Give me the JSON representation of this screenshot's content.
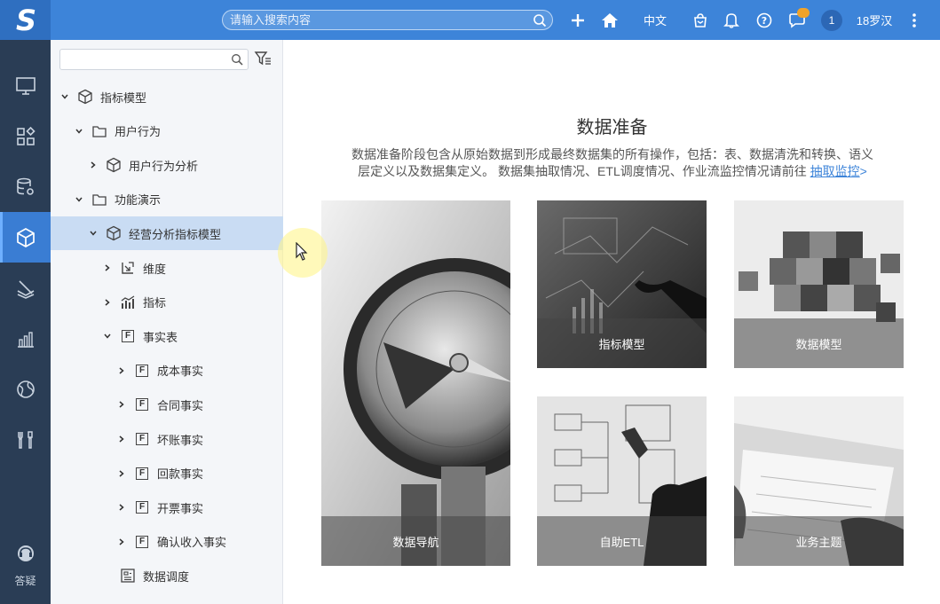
{
  "app": {
    "logo_text": "S"
  },
  "topbar": {
    "search_placeholder": "请输入搜索内容",
    "lang": "中文",
    "user_count": "1",
    "user_name": "18罗汉",
    "accent": "#3d84d9"
  },
  "rail": {
    "items": [
      {
        "icon": "monitor-icon"
      },
      {
        "icon": "apps-icon"
      },
      {
        "icon": "database-settings-icon"
      },
      {
        "icon": "cube-icon",
        "active": true
      },
      {
        "icon": "layers-icon"
      },
      {
        "icon": "bar-chart-icon"
      },
      {
        "icon": "globe-icon"
      },
      {
        "icon": "tools-icon"
      }
    ],
    "help_label": "答疑"
  },
  "tree": {
    "nodes": [
      {
        "label": "指标模型",
        "icon": "cube-icon",
        "caret": "down",
        "indent": 0
      },
      {
        "label": "用户行为",
        "icon": "folder-icon",
        "caret": "down",
        "indent": 1
      },
      {
        "label": "用户行为分析",
        "icon": "cube-icon",
        "caret": "right",
        "indent": 2
      },
      {
        "label": "功能演示",
        "icon": "folder-icon",
        "caret": "down",
        "indent": 1
      },
      {
        "label": "经营分析指标模型",
        "icon": "cube-icon",
        "caret": "down",
        "indent": 2,
        "selected": true
      },
      {
        "label": "维度",
        "icon": "dimension-icon",
        "caret": "right",
        "indent": 3
      },
      {
        "label": "指标",
        "icon": "metric-icon",
        "caret": "right",
        "indent": 3
      },
      {
        "label": "事实表",
        "icon": "fact-table-icon",
        "caret": "down",
        "indent": 3
      },
      {
        "label": "成本事实",
        "icon": "fact-table-icon",
        "caret": "right",
        "indent": 4
      },
      {
        "label": "合同事实",
        "icon": "fact-table-icon",
        "caret": "right",
        "indent": 4
      },
      {
        "label": "坏账事实",
        "icon": "fact-table-icon",
        "caret": "right",
        "indent": 4
      },
      {
        "label": "回款事实",
        "icon": "fact-table-icon",
        "caret": "right",
        "indent": 4
      },
      {
        "label": "开票事实",
        "icon": "fact-table-icon",
        "caret": "right",
        "indent": 4
      },
      {
        "label": "确认收入事实",
        "icon": "fact-table-icon",
        "caret": "right",
        "indent": 4
      },
      {
        "label": "数据调度",
        "icon": "schedule-icon",
        "caret": "none",
        "indent": 3
      }
    ]
  },
  "main": {
    "title": "数据准备",
    "desc": "数据准备阶段包含从原始数据到形成最终数据集的所有操作，包括：表、数据清洗和转换、语义层定义以及数据集定义。 数据集抽取情况、ETL调度情况、作业流监控情况请前往",
    "link_label": "抽取监控",
    "link_arrow": ">",
    "cards": [
      {
        "label": "数据导航",
        "image": "compass"
      },
      {
        "label": "指标模型",
        "image": "touchscreen"
      },
      {
        "label": "数据模型",
        "image": "cubes"
      },
      {
        "label": "自助ETL",
        "image": "whiteboard"
      },
      {
        "label": "业务主题",
        "image": "laptop"
      }
    ]
  }
}
